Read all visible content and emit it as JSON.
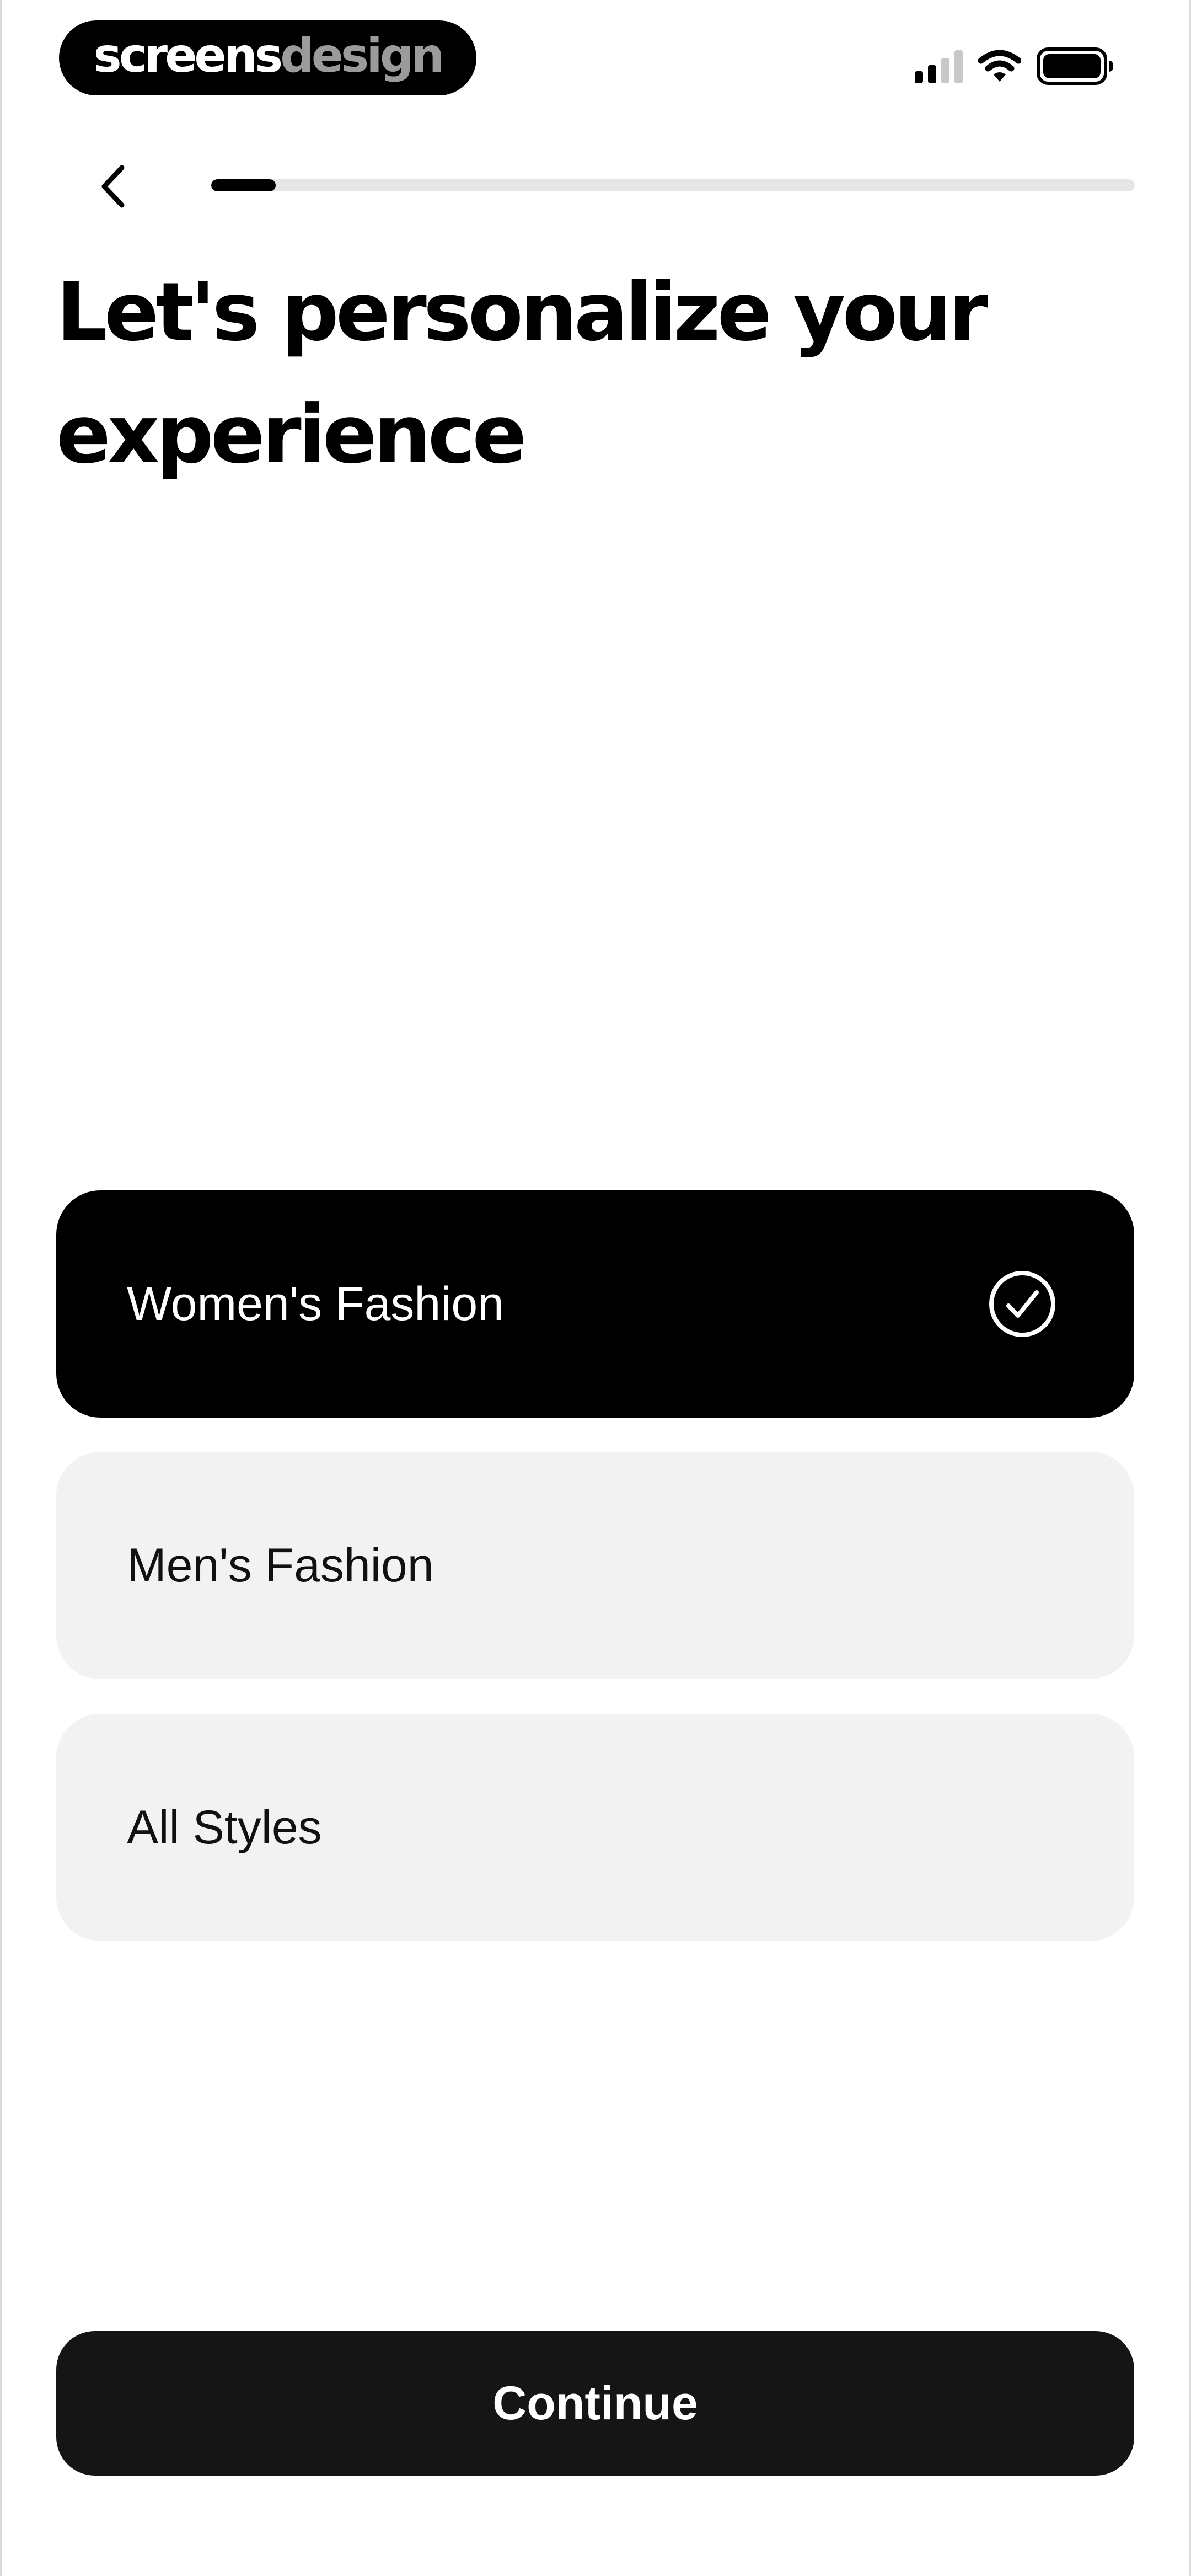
{
  "status_bar": {
    "brand_strong": "screens",
    "brand_light": "design",
    "signal_bars": 2,
    "signal_bars_total": 4,
    "icons": [
      "cellular-signal-icon",
      "wifi-icon",
      "battery-icon"
    ]
  },
  "navigation": {
    "back_icon": "chevron-left-icon",
    "progress_fraction": 0.07
  },
  "title": "Let's personalize your experience",
  "options": [
    {
      "label": "Women's Fashion",
      "selected": true
    },
    {
      "label": "Men's Fashion",
      "selected": false
    },
    {
      "label": "All Styles",
      "selected": false
    }
  ],
  "selected_icon": "check-circle-icon",
  "continue_label": "Continue",
  "colors": {
    "selected_background": "#000000",
    "option_background": "#f2f2f2",
    "primary_button": "#151515",
    "progress_track": "#e6e6e6",
    "progress_fill": "#000000"
  }
}
